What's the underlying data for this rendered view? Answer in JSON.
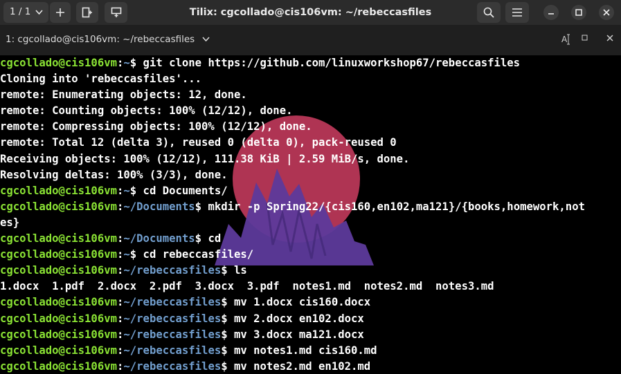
{
  "titlebar": {
    "session_counter": "1 / 1",
    "title": "Tilix: cgcollado@cis106vm: ~/rebeccasfiles"
  },
  "subbar": {
    "terminal_label": "1: cgcollado@cis106vm: ~/rebeccasfiles"
  },
  "terminal": {
    "lines": [
      {
        "segments": [
          {
            "t": "cgcollado@cis106vm",
            "c": "u"
          },
          {
            "t": ":",
            "c": "w"
          },
          {
            "t": "~",
            "c": "p"
          },
          {
            "t": "$ git clone https://github.com/linuxworkshop67/rebeccasfiles",
            "c": "w"
          }
        ]
      },
      {
        "segments": [
          {
            "t": "Cloning into 'rebeccasfiles'...",
            "c": "w"
          }
        ]
      },
      {
        "segments": [
          {
            "t": "remote: Enumerating objects: 12, done.",
            "c": "w"
          }
        ]
      },
      {
        "segments": [
          {
            "t": "remote: Counting objects: 100% (12/12), done.",
            "c": "w"
          }
        ]
      },
      {
        "segments": [
          {
            "t": "remote: Compressing objects: 100% (12/12), done.",
            "c": "w"
          }
        ]
      },
      {
        "segments": [
          {
            "t": "remote: Total 12 (delta 3), reused 0 (delta 0), pack-reused 0",
            "c": "w"
          }
        ]
      },
      {
        "segments": [
          {
            "t": "Receiving objects: 100% (12/12), 111.38 KiB | 2.59 MiB/s, done.",
            "c": "w"
          }
        ]
      },
      {
        "segments": [
          {
            "t": "Resolving deltas: 100% (3/3), done.",
            "c": "w"
          }
        ]
      },
      {
        "segments": [
          {
            "t": "cgcollado@cis106vm",
            "c": "u"
          },
          {
            "t": ":",
            "c": "w"
          },
          {
            "t": "~",
            "c": "p"
          },
          {
            "t": "$ cd Documents/",
            "c": "w"
          }
        ]
      },
      {
        "segments": [
          {
            "t": "cgcollado@cis106vm",
            "c": "u"
          },
          {
            "t": ":",
            "c": "w"
          },
          {
            "t": "~/Documents",
            "c": "p"
          },
          {
            "t": "$ mkdir -p Spring22/{cis160,en102,ma121}/{books,homework,not",
            "c": "w"
          }
        ]
      },
      {
        "segments": [
          {
            "t": "es}",
            "c": "w"
          }
        ]
      },
      {
        "segments": [
          {
            "t": "cgcollado@cis106vm",
            "c": "u"
          },
          {
            "t": ":",
            "c": "w"
          },
          {
            "t": "~/Documents",
            "c": "p"
          },
          {
            "t": "$ cd",
            "c": "w"
          }
        ]
      },
      {
        "segments": [
          {
            "t": "cgcollado@cis106vm",
            "c": "u"
          },
          {
            "t": ":",
            "c": "w"
          },
          {
            "t": "~",
            "c": "p"
          },
          {
            "t": "$ cd rebeccasfiles/",
            "c": "w"
          }
        ]
      },
      {
        "segments": [
          {
            "t": "cgcollado@cis106vm",
            "c": "u"
          },
          {
            "t": ":",
            "c": "w"
          },
          {
            "t": "~/rebeccasfiles",
            "c": "p"
          },
          {
            "t": "$ ls",
            "c": "w"
          }
        ]
      },
      {
        "segments": [
          {
            "t": "1.docx  1.pdf  2.docx  2.pdf  3.docx  3.pdf  notes1.md  notes2.md  notes3.md",
            "c": "w"
          }
        ]
      },
      {
        "segments": [
          {
            "t": "cgcollado@cis106vm",
            "c": "u"
          },
          {
            "t": ":",
            "c": "w"
          },
          {
            "t": "~/rebeccasfiles",
            "c": "p"
          },
          {
            "t": "$ mv 1.docx cis160.docx",
            "c": "w"
          }
        ]
      },
      {
        "segments": [
          {
            "t": "cgcollado@cis106vm",
            "c": "u"
          },
          {
            "t": ":",
            "c": "w"
          },
          {
            "t": "~/rebeccasfiles",
            "c": "p"
          },
          {
            "t": "$ mv 2.docx en102.docx",
            "c": "w"
          }
        ]
      },
      {
        "segments": [
          {
            "t": "cgcollado@cis106vm",
            "c": "u"
          },
          {
            "t": ":",
            "c": "w"
          },
          {
            "t": "~/rebeccasfiles",
            "c": "p"
          },
          {
            "t": "$ mv 3.docx ma121.docx",
            "c": "w"
          }
        ]
      },
      {
        "segments": [
          {
            "t": "cgcollado@cis106vm",
            "c": "u"
          },
          {
            "t": ":",
            "c": "w"
          },
          {
            "t": "~/rebeccasfiles",
            "c": "p"
          },
          {
            "t": "$ mv notes1.md cis160.md",
            "c": "w"
          }
        ]
      },
      {
        "segments": [
          {
            "t": "cgcollado@cis106vm",
            "c": "u"
          },
          {
            "t": ":",
            "c": "w"
          },
          {
            "t": "~/rebeccasfiles",
            "c": "p"
          },
          {
            "t": "$ mv notes2.md en102.md",
            "c": "w"
          }
        ]
      }
    ]
  },
  "colors": {
    "user_host": "#8ae234",
    "path": "#729fcf",
    "text": "#ffffff",
    "background": "#000000",
    "logo_sun": "#c23a5c",
    "logo_mountain": "#5d3a9b"
  },
  "icons": [
    "chevron-down-icon",
    "plus-icon",
    "split-right-icon",
    "split-down-icon",
    "search-icon",
    "hamburger-menu-icon",
    "minimize-icon",
    "maximize-icon",
    "close-icon",
    "text-cursor-icon",
    "maximize-terminal-icon",
    "close-terminal-icon"
  ]
}
